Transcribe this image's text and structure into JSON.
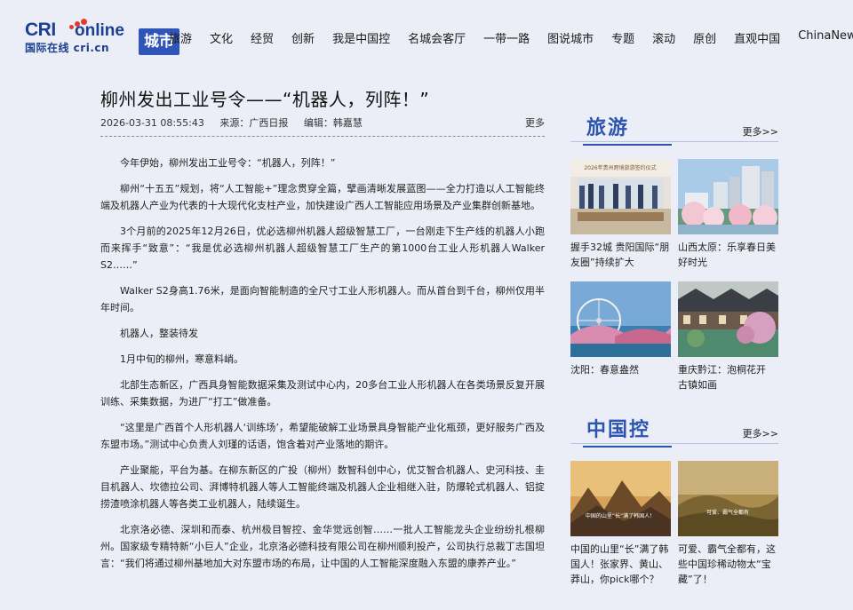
{
  "header": {
    "logo_cri": "CRI",
    "logo_online": "online",
    "logo_sub": "国际在线 cri.cn",
    "logo_badge": "城市",
    "nav": [
      "旅游",
      "文化",
      "经贸",
      "创新",
      "我是中国控",
      "名城会客厅",
      "一带一路",
      "图说城市",
      "专题",
      "滚动",
      "原创",
      "直观中国",
      "ChinaNews"
    ]
  },
  "article": {
    "title": "柳州发出工业号令——“机器人，列阵！”",
    "date": "2026-03-31 08:55:43",
    "source": "来源：广西日报",
    "editor": "编辑：韩嘉慧",
    "more": "更多",
    "paragraphs": [
      "今年伊始，柳州发出工业号令：“机器人，列阵！”",
      "柳州“十五五”规划，将“人工智能+”理念贯穿全篇，擘画清晰发展蓝图——全力打造以人工智能终端及机器人产业为代表的十大现代化支柱产业，加快建设广西人工智能应用场景及产业集群创新基地。",
      "3个月前的2025年12月26日，优必选柳州机器人超级智慧工厂，一台刚走下生产线的机器人小跑而来挥手“致意”：“我是优必选柳州机器人超级智慧工厂生产的第1000台工业人形机器人Walker S2……”",
      "Walker S2身高1.76米，是面向智能制造的全尺寸工业人形机器人。而从首台到千台，柳州仅用半年时间。",
      "机器人，整装待发",
      "1月中旬的柳州，寒意料峭。",
      "北部生态新区，广西具身智能数据采集及测试中心内，20多台工业人形机器人在各类场景反复开展训练、采集数据，为进厂“打工”做准备。",
      "“这里是广西首个人形机器人‘训练场’，希望能破解工业场景具身智能产业化瓶颈，更好服务广西及东盟市场。”测试中心负责人刘瑾的话语，饱含着对产业落地的期许。",
      "产业聚能，平台为基。在柳东新区的广投（柳州）数智科创中心，优艾智合机器人、史河科技、圭目机器人、坎德拉公司、湃博特机器人等人工智能终端及机器人企业相继入驻，防爆轮式机器人、铝掟捞渣喷涂机器人等各类工业机器人，陆续诞生。",
      "北京洛必德、深圳和而泰、杭州极目智控、金华觉远创智……一批人工智能龙头企业纷纷扎根柳州。国家级专精特新“小巨人”企业，北京洛必德科技有限公司在柳州顺利投产，公司执行总裁丁志国坦言：“我们将通过柳州基地加大对东盟市场的布局，让中国的人工智能深度融入东盟的康养产业。”"
    ]
  },
  "travel": {
    "title": "旅游",
    "more": "更多>>",
    "items": [
      {
        "caption": "握手32城 贵阳国际“朋友圈”持续扩大",
        "image_text": "2026年贵州跨境旅游签约仪式"
      },
      {
        "caption": "山西太原：乐享春日美好时光"
      },
      {
        "caption": "沈阳：春意盎然"
      },
      {
        "caption": "重庆黔江：泡桐花开 古镇如画"
      }
    ]
  },
  "china": {
    "title": "中国控",
    "more": "更多>>",
    "items": [
      {
        "caption": "中国的山里“长”满了韩国人！张家界、黄山、莽山，你pick哪个？",
        "image_text": "中国的山里“长”满了韩国人！"
      },
      {
        "caption": "可爱、霸气全都有，这些中国珍稀动物太“宝藏”了！",
        "image_text": "可爱、霸气全都有"
      }
    ]
  },
  "colors": {
    "accent": "#2b55b0",
    "page_bg": "#ebeef7",
    "logo_red": "#e23a2e"
  }
}
